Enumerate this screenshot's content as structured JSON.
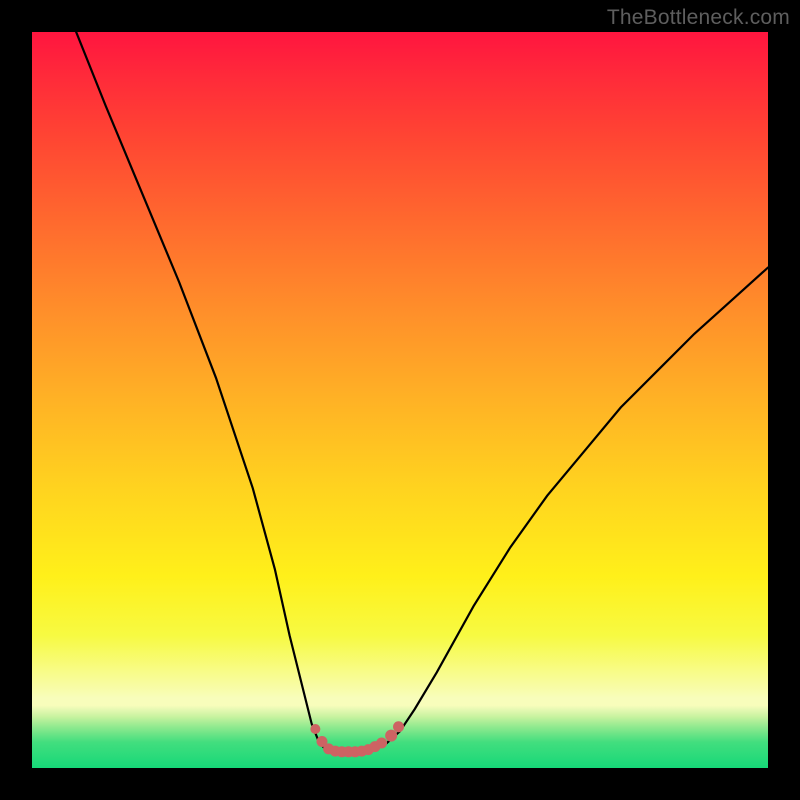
{
  "watermark": "TheBottleneck.com",
  "colors": {
    "frame": "#000000",
    "gradient_top": "#ff153f",
    "gradient_mid": "#ffd31f",
    "gradient_bottom": "#16d878",
    "curve": "#000000",
    "marker": "#cd6363"
  },
  "chart_data": {
    "type": "line",
    "title": "",
    "xlabel": "",
    "ylabel": "",
    "xlim": [
      0,
      100
    ],
    "ylim": [
      0,
      100
    ],
    "grid": false,
    "legend": false,
    "series": [
      {
        "name": "bottleneck-curve",
        "x": [
          6,
          10,
          15,
          20,
          25,
          30,
          33,
          35,
          37,
          38,
          39,
          40,
          42,
          44,
          46,
          48,
          50,
          52,
          55,
          60,
          65,
          70,
          75,
          80,
          85,
          90,
          95,
          100
        ],
        "y": [
          100,
          90,
          78,
          66,
          53,
          38,
          27,
          18,
          10,
          6,
          3.5,
          2.4,
          2.2,
          2.2,
          2.4,
          3.2,
          5,
          8,
          13,
          22,
          30,
          37,
          43,
          49,
          54,
          59,
          63.5,
          68
        ]
      }
    ],
    "markers": {
      "name": "bottom-cluster",
      "x": [
        38.5,
        39.4,
        40.3,
        41.2,
        42.1,
        43.0,
        43.9,
        44.8,
        45.7,
        46.6,
        47.5,
        48.8,
        49.8
      ],
      "y": [
        5.3,
        3.6,
        2.6,
        2.3,
        2.2,
        2.2,
        2.2,
        2.3,
        2.5,
        2.9,
        3.4,
        4.4,
        5.6
      ],
      "size": [
        10,
        11,
        11,
        11,
        11,
        11,
        11,
        11,
        11,
        11,
        11,
        12,
        11
      ]
    }
  }
}
